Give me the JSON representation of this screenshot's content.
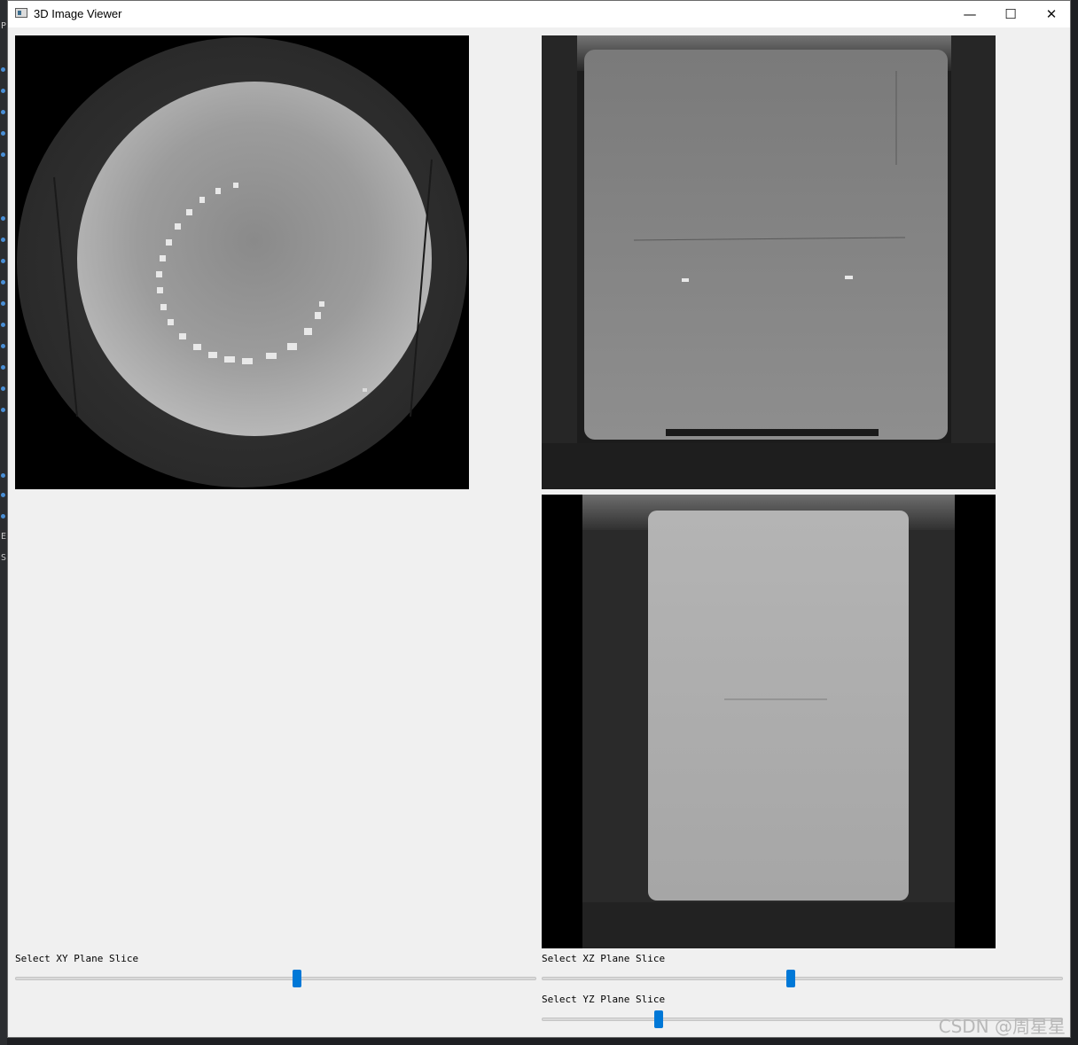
{
  "window": {
    "title": "3D Image Viewer",
    "minimize_glyph": "—",
    "maximize_glyph": "☐",
    "close_glyph": "✕"
  },
  "ide_strip": {
    "letters": [
      "P",
      "E",
      "S"
    ]
  },
  "sliders": {
    "xy": {
      "label": "Select XY Plane Slice",
      "position": 0.54
    },
    "xz": {
      "label": "Select XZ Plane Slice",
      "position": 0.478
    },
    "yz": {
      "label": "Select YZ Plane Slice",
      "position": 0.225
    }
  },
  "watermark": "CSDN @周星星",
  "colors": {
    "accent": "#0078d7",
    "window_bg": "#f0f0f0",
    "titlebar_bg": "#ffffff"
  }
}
